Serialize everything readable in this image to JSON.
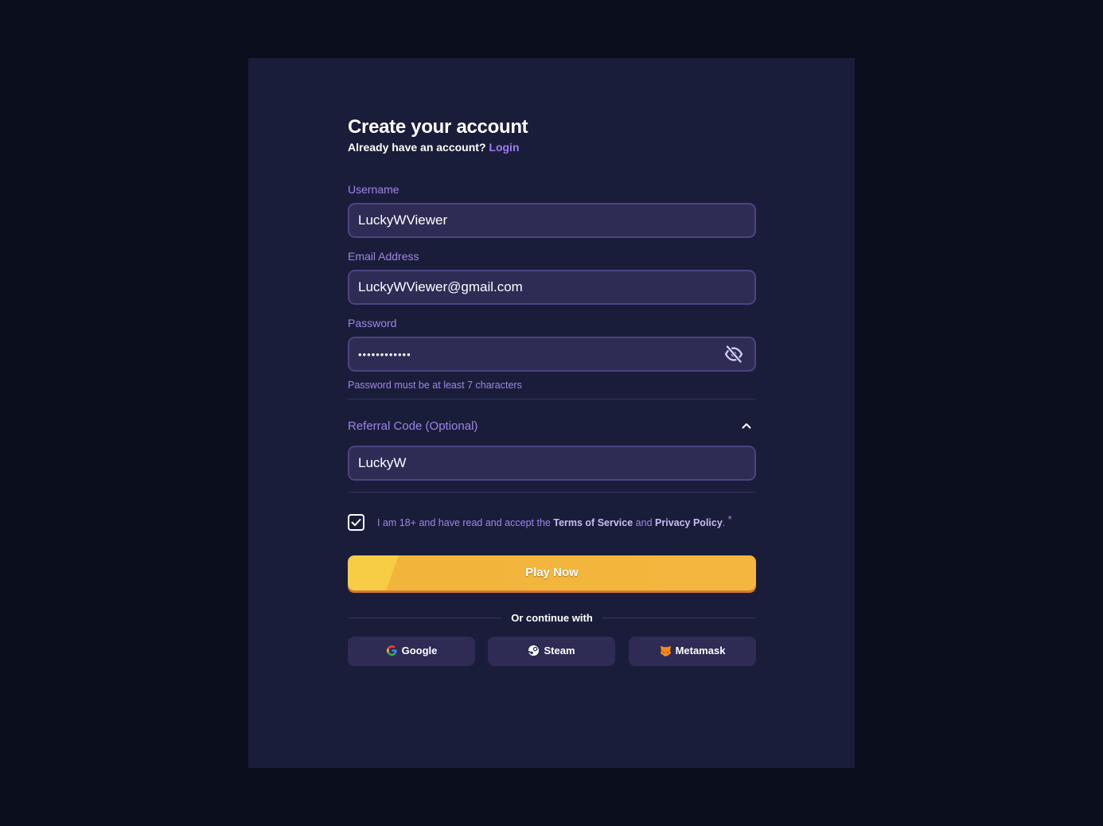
{
  "header": {
    "title": "Create your account",
    "subtitle_text": "Already have an account?",
    "login_link": "Login"
  },
  "fields": {
    "username": {
      "label": "Username",
      "value": "LuckyWViewer"
    },
    "email": {
      "label": "Email Address",
      "value": "LuckyWViewer@gmail.com"
    },
    "password": {
      "label": "Password",
      "value": "••••••••••••",
      "hint": "Password must be at least 7 characters"
    },
    "referral": {
      "label": "Referral Code (Optional)",
      "value": "LuckyW",
      "expanded": true
    }
  },
  "terms": {
    "checked": true,
    "text_before": "I am 18+ and have read and accept the",
    "terms_link": "Terms of Service",
    "text_and": "and",
    "privacy_link": "Privacy Policy",
    "text_after": ".",
    "required_mark": "*"
  },
  "actions": {
    "play_label": "Play Now",
    "divider_text": "Or continue with"
  },
  "social": [
    {
      "label": "Google",
      "icon": "google-icon"
    },
    {
      "label": "Steam",
      "icon": "steam-icon"
    },
    {
      "label": "Metamask",
      "icon": "metamask-icon"
    }
  ],
  "colors": {
    "background": "#0b0e1c",
    "panel": "#1a1d3a",
    "field": "#2e2b55",
    "accent": "#9d7bf0",
    "button": "#f3b63e"
  }
}
